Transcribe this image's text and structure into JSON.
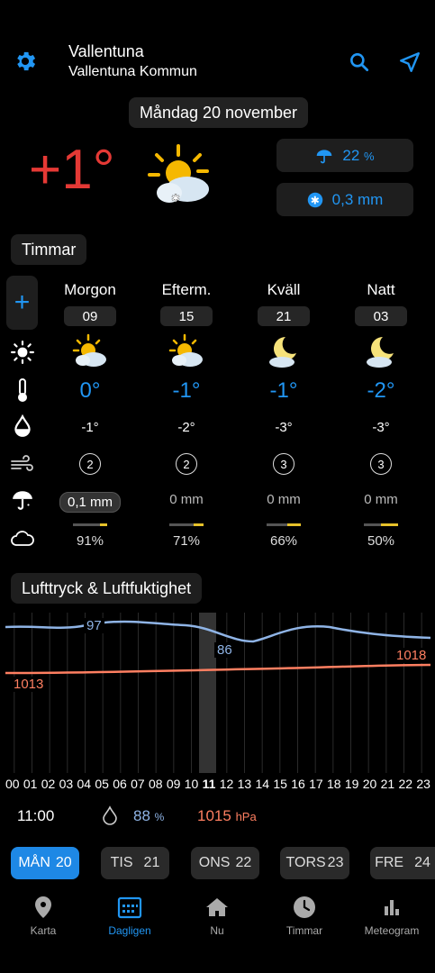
{
  "header": {
    "location_name": "Vallentuna",
    "location_sub": "Vallentuna Kommun",
    "date": "Måndag 20 november"
  },
  "current": {
    "temp": "+1°",
    "precip_chance": "22",
    "precip_chance_unit": "%",
    "precip_amount": "0,3 mm"
  },
  "hours_section": {
    "title": "Timmar",
    "columns": [
      {
        "period": "Morgon",
        "hour": "09",
        "temp": "0°",
        "feels": "-1°",
        "wind": "2",
        "rain": "0,1 mm",
        "cloud": "91%",
        "cloud_frac": 0.2
      },
      {
        "period": "Efterm.",
        "hour": "15",
        "temp": "-1°",
        "feels": "-2°",
        "wind": "2",
        "rain": "0 mm",
        "cloud": "71%",
        "cloud_frac": 0.3
      },
      {
        "period": "Kväll",
        "hour": "21",
        "temp": "-1°",
        "feels": "-3°",
        "wind": "3",
        "rain": "0 mm",
        "cloud": "66%",
        "cloud_frac": 0.4
      },
      {
        "period": "Natt",
        "hour": "03",
        "temp": "-2°",
        "feels": "-3°",
        "wind": "3",
        "rain": "0 mm",
        "cloud": "50%",
        "cloud_frac": 0.5
      }
    ]
  },
  "pressure_section": {
    "title": "Lufttryck & Luftfuktighet",
    "humidity_label_1": "97",
    "humidity_label_2": "86",
    "pressure_label_1": "1013",
    "pressure_label_2": "1018",
    "hours": [
      "00",
      "01",
      "02",
      "03",
      "04",
      "05",
      "06",
      "07",
      "08",
      "09",
      "10",
      "11",
      "12",
      "13",
      "14",
      "15",
      "16",
      "17",
      "18",
      "19",
      "20",
      "21",
      "22",
      "23"
    ],
    "selected_hour": "11",
    "readout_time": "11:00",
    "readout_humidity": "88",
    "readout_humidity_unit": "%",
    "readout_pressure": "1015",
    "readout_pressure_unit": "hPa"
  },
  "day_tabs": [
    {
      "day": "MÅN",
      "date": "20"
    },
    {
      "day": "TIS",
      "date": "21"
    },
    {
      "day": "ONS",
      "date": "22"
    },
    {
      "day": "TORS",
      "date": "23"
    },
    {
      "day": "FRE",
      "date": "24"
    }
  ],
  "nav": [
    {
      "label": "Karta",
      "icon": "map-pin-icon"
    },
    {
      "label": "Dagligen",
      "icon": "calendar-icon"
    },
    {
      "label": "Nu",
      "icon": "home-icon"
    },
    {
      "label": "Timmar",
      "icon": "clock-icon"
    },
    {
      "label": "Meteogram",
      "icon": "bar-chart-icon"
    }
  ],
  "colors": {
    "accent": "#2196f3",
    "temp_red": "#e53935",
    "humidity_line": "#8fb4e6",
    "pressure_line": "#ff7f61",
    "sun": "#f5b800"
  }
}
